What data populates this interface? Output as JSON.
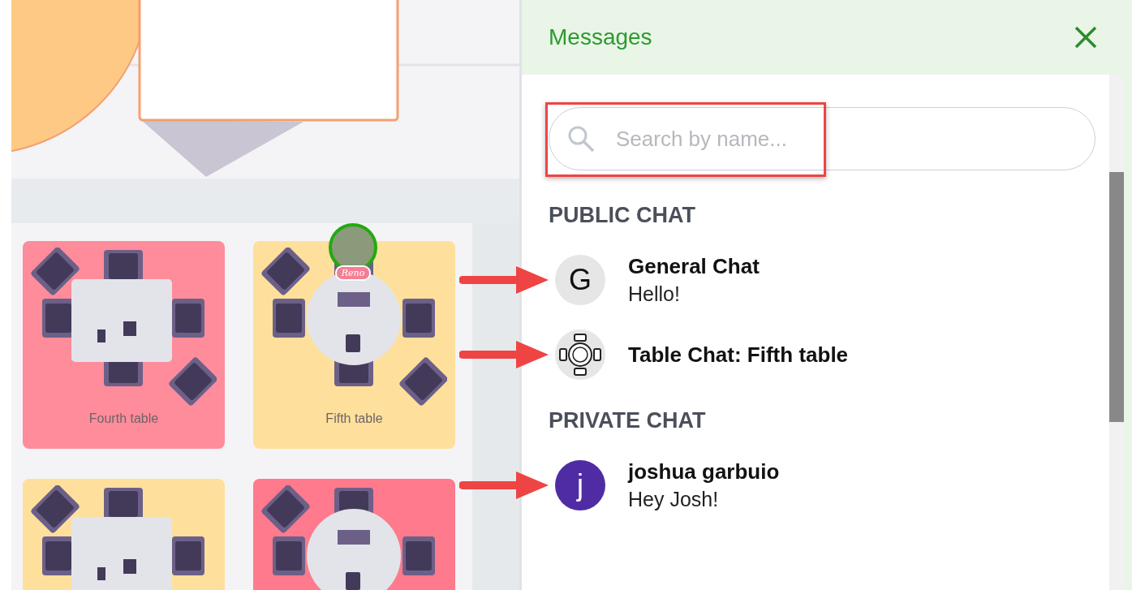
{
  "floor": {
    "tables": [
      {
        "label": "Fourth table",
        "kind": "square",
        "color": "#fe8c9a"
      },
      {
        "label": "Fifth table",
        "kind": "round",
        "color": "#fee09c",
        "occupant": {
          "name": "Reno"
        }
      },
      {
        "kind": "square",
        "color": "#fee09c"
      },
      {
        "kind": "round",
        "color": "#fe7a8c"
      }
    ]
  },
  "messages": {
    "title": "Messages",
    "search": {
      "placeholder": "Search by name...",
      "highlighted": true
    },
    "sections": [
      {
        "heading": "PUBLIC CHAT",
        "chats": [
          {
            "kind": "letter",
            "avatar": "G",
            "color": "#e6e6e6",
            "name": "General Chat",
            "preview": "Hello!",
            "arrow": true
          },
          {
            "kind": "table",
            "name": "Table Chat: Fifth table",
            "arrow": true
          }
        ]
      },
      {
        "heading": "PRIVATE CHAT",
        "chats": [
          {
            "kind": "letter",
            "avatar": "j",
            "color": "#4f2ca4",
            "name": "joshua garbuio",
            "preview": "Hey Josh!",
            "arrow": true
          }
        ]
      }
    ]
  }
}
